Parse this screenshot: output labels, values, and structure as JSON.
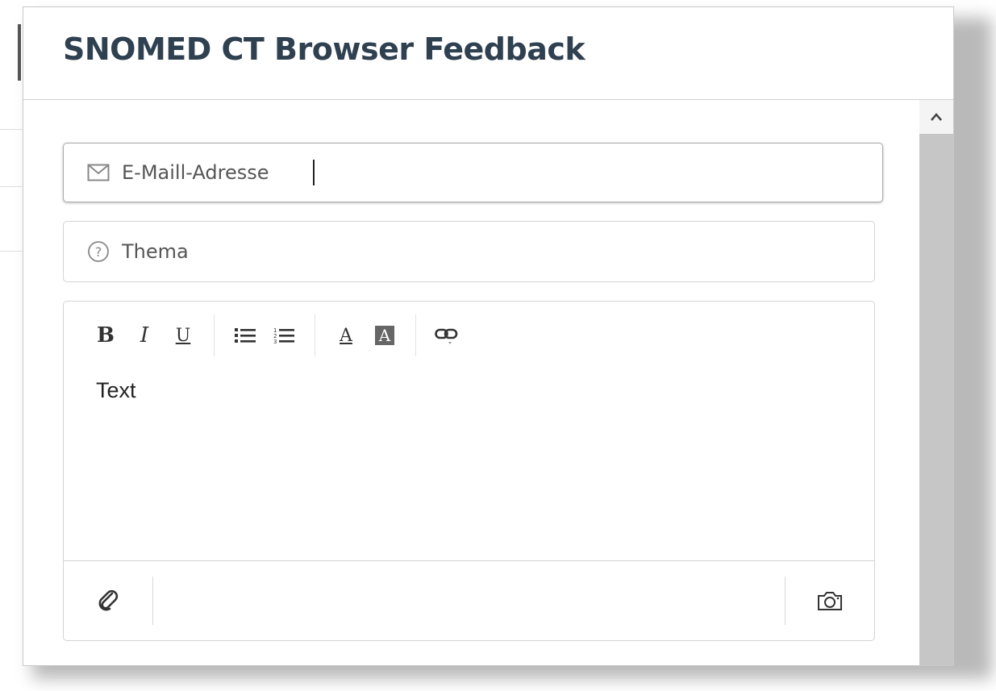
{
  "dialog": {
    "title": "SNOMED CT Browser Feedback"
  },
  "form": {
    "email": {
      "value": "E-Maill-Adresse",
      "icon": "mail-icon"
    },
    "topic": {
      "placeholder": "Thema",
      "icon": "question-circle-icon"
    },
    "editor": {
      "text": "Text",
      "toolbar": {
        "bold": "B",
        "italic": "I",
        "underline": "U",
        "bullet_list_icon": "bulleted-list-icon",
        "numbered_list_icon": "numbered-list-icon",
        "font_color": "A",
        "background_color": "A",
        "link_icon": "link-icon"
      },
      "footer": {
        "attach_icon": "paperclip-icon",
        "screenshot_icon": "camera-icon"
      }
    }
  },
  "colors": {
    "title": "#2f4050",
    "border": "#d4d4d4",
    "scrollbar_thumb": "#c6c6c6"
  }
}
